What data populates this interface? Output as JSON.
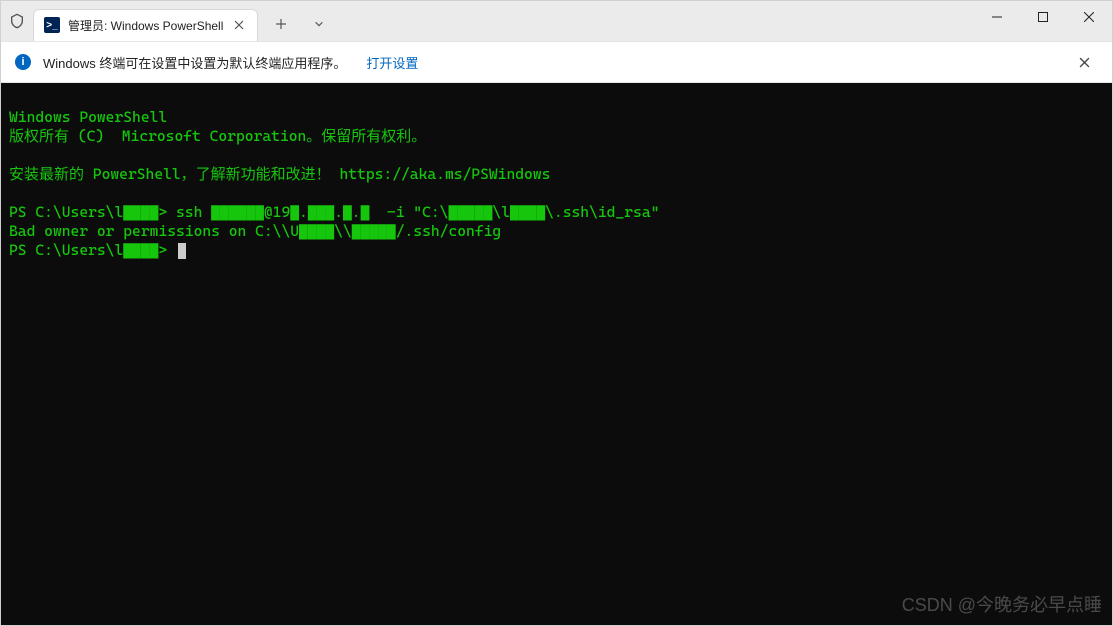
{
  "titlebar": {
    "tab": {
      "title": "管理员: Windows PowerShell",
      "icon_label": ">_"
    }
  },
  "infobar": {
    "message": "Windows 终端可在设置中设置为默认终端应用程序。",
    "link": "打开设置"
  },
  "terminal": {
    "line1": "Windows PowerShell",
    "line2": "版权所有 (C)  Microsoft Corporation。保留所有权利。",
    "line3": "安装最新的 PowerShell，了解新功能和改进！ https://aka.ms/PSWindows",
    "prompt1": "PS C:\\Users\\l▇▇▇▇>",
    "cmd1": " ssh ▇▇▇▇▇▇@19▇.▇▇▇.▇.▇  -i \"C:\\▇▇▇▇▇\\l▇▇▇▇\\.ssh\\id_rsa\"",
    "err": "Bad owner or permissions on C:\\\\U▇▇▇▇\\\\▇▇▇▇▇/.ssh/config",
    "prompt2": "PS C:\\Users\\l▇▇▇▇>"
  },
  "watermark": "CSDN @今晚务必早点睡"
}
